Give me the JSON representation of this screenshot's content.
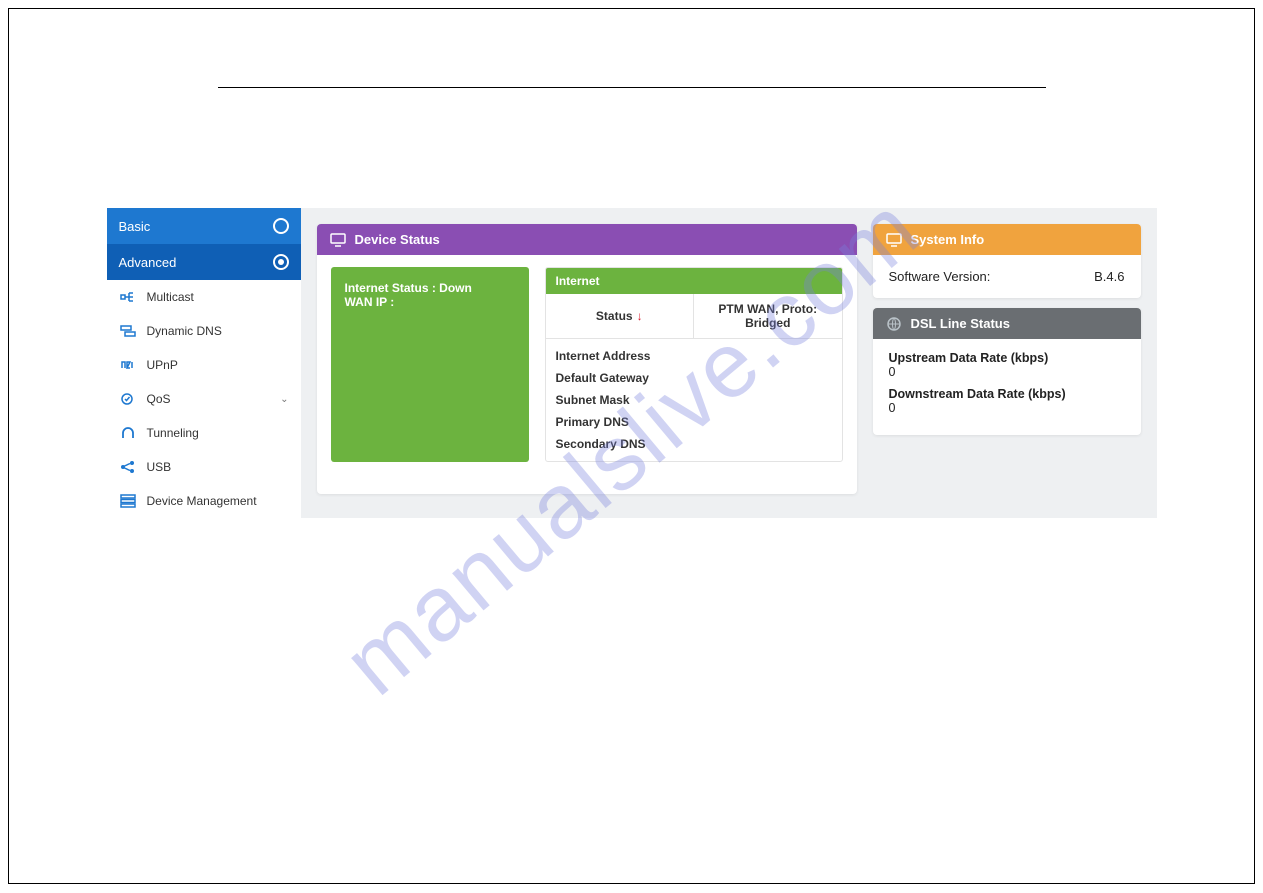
{
  "watermark": "manualslive.com",
  "sidebar": {
    "basic_label": "Basic",
    "advanced_label": "Advanced",
    "items": [
      {
        "label": "Multicast"
      },
      {
        "label": "Dynamic DNS"
      },
      {
        "label": "UPnP"
      },
      {
        "label": "QoS"
      },
      {
        "label": "Tunneling"
      },
      {
        "label": "USB"
      },
      {
        "label": "Device Management"
      }
    ]
  },
  "device_status": {
    "header": "Device Status",
    "internet_status_label": "Internet Status : Down",
    "wan_ip_label": "WAN IP :",
    "internet_header": "Internet",
    "status_label": "Status",
    "wan_proto": "PTM WAN, Proto: Bridged",
    "attrs": [
      "Internet Address",
      "Default Gateway",
      "Subnet Mask",
      "Primary DNS",
      "Secondary DNS"
    ]
  },
  "system_info": {
    "header": "System Info",
    "software_version_label": "Software Version:",
    "software_version_value": "B.4.6"
  },
  "dsl": {
    "header": "DSL Line Status",
    "upstream_label": "Upstream Data Rate (kbps)",
    "upstream_value": "0",
    "downstream_label": "Downstream Data Rate (kbps)",
    "downstream_value": "0"
  }
}
